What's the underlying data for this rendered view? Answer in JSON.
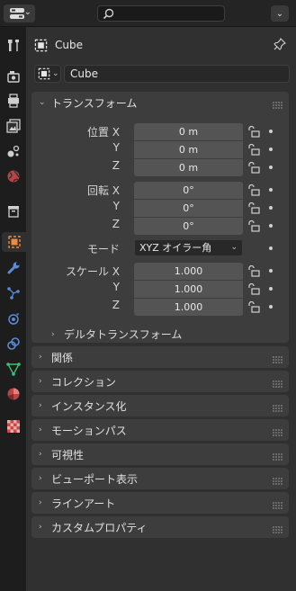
{
  "header": {
    "object_name": "Cube",
    "data_name": "Cube"
  },
  "transform": {
    "title": "トランスフォーム",
    "location": {
      "label": "位置 X",
      "axes": [
        "X",
        "Y",
        "Z"
      ],
      "values": [
        "0 m",
        "0 m",
        "0 m"
      ]
    },
    "rotation": {
      "label": "回転 X",
      "values": [
        "0°",
        "0°",
        "0°"
      ]
    },
    "mode": {
      "label": "モード",
      "value": "XYZ オイラー角"
    },
    "scale": {
      "label": "スケール X",
      "values": [
        "1.000",
        "1.000",
        "1.000"
      ]
    },
    "delta": "デルタトランスフォーム"
  },
  "panels": [
    "関係",
    "コレクション",
    "インスタンス化",
    "モーションパス",
    "可視性",
    "ビューポート表示",
    "ラインアート",
    "カスタムプロパティ"
  ]
}
